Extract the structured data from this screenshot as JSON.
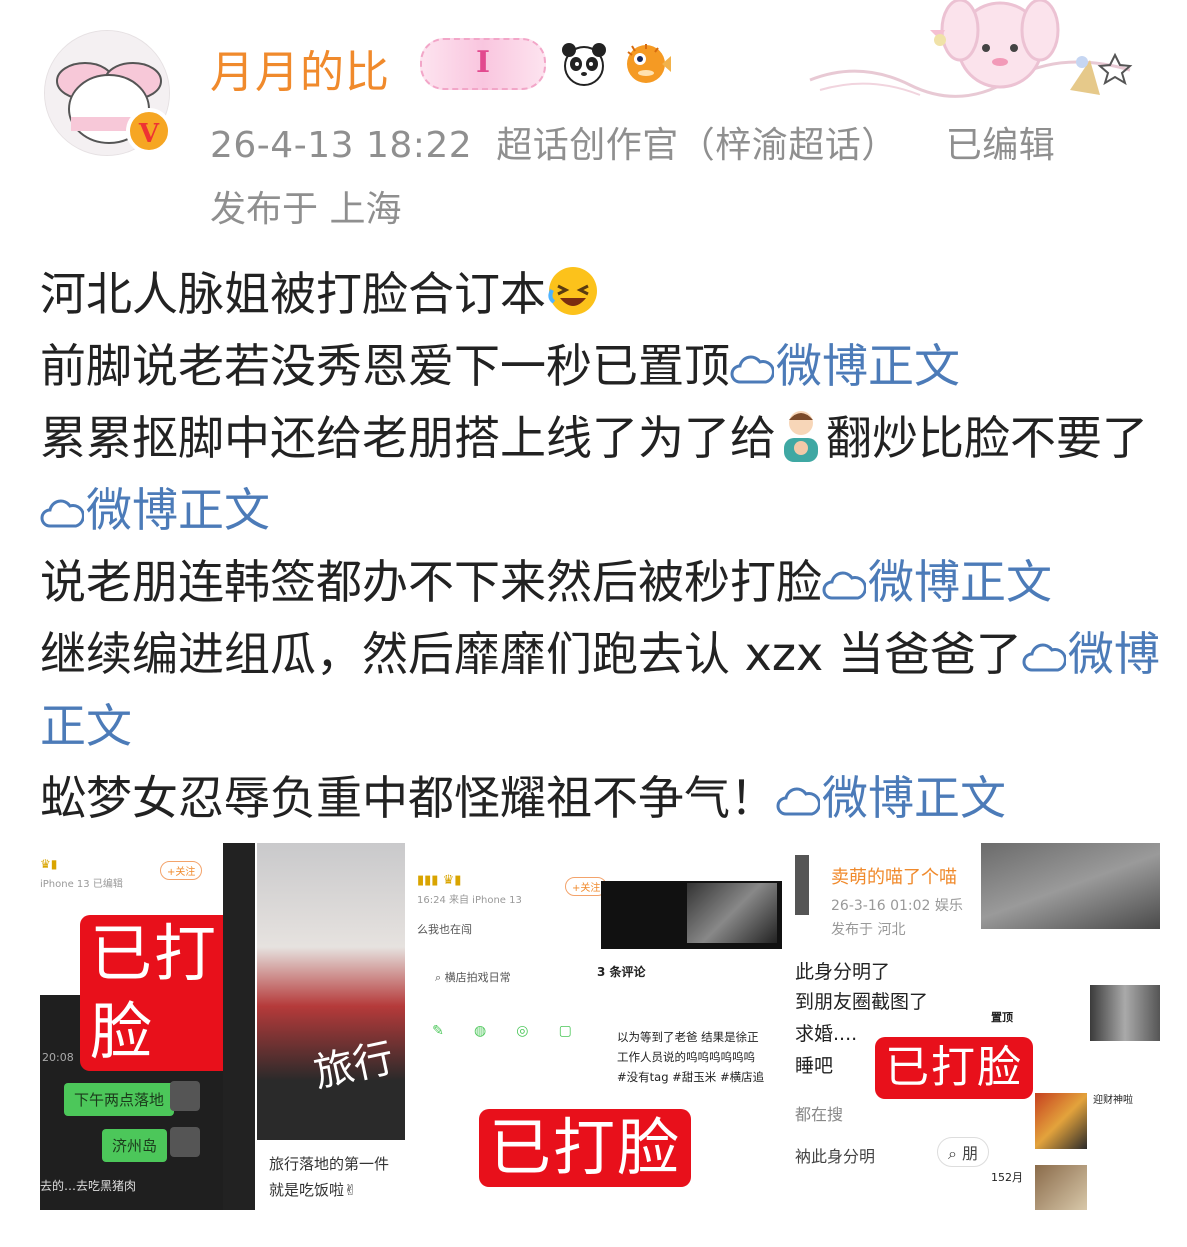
{
  "header": {
    "username": "月月的比",
    "badge_pill_text": "I",
    "icon_panda": "panda-emoji-icon",
    "icon_fish": "pufferfish-emoji-icon",
    "timestamp": "26-4-13 18:22",
    "source": "超话创作官（梓渝超话）",
    "edited": "已编辑",
    "location": "发布于 上海"
  },
  "post": {
    "line1": "河北人脉姐被打脸合订本",
    "line2": "前脚说老若没秀恩爱下一秒已置顶",
    "line3a": "累累抠脚中还给老朋搭上线了为了给",
    "line3b": "翻炒比脸不要了",
    "line4": "说老朋连韩签都办不下来然后被秒打脸",
    "line5": "继续编进组瓜，然后靡靡们跑去认 xzx 当爸爸了",
    "line6": "蚣梦女忍辱负重中都怪耀祖不争气！",
    "link_label": "微博正文"
  },
  "images": {
    "stamp": "已打脸",
    "tile1": {
      "device": "iPhone 13  已编辑",
      "follow": "+关注",
      "time": "20:08",
      "bubble1": "下午两点落地",
      "bubble2": "济州岛",
      "bottom": "去的…去吃黑猪肉"
    },
    "tile2": {
      "overlay": "旅行",
      "caption1": "旅行落地的第一件",
      "caption2": "就是吃饭啦✌"
    },
    "tile3": {
      "meta": "16:24  来自 iPhone 13",
      "follow": "+关注",
      "line1": "么我也在闯",
      "search": "横店拍戏日常",
      "comments": "3 条评论",
      "c1": "以为等到了老爸 结果是徐正",
      "c2": "工作人员说的呜呜呜呜呜呜",
      "c3": "#没有tag #甜玉米 #横店追"
    },
    "tile4": {
      "name": "卖萌的喵了个喵",
      "time": "26-3-16 01:02  娱乐",
      "loc": "发布于 河北",
      "t1": "此身分明了",
      "t2": "到朋友圈截图了",
      "t3": "求婚....",
      "t4": "睡吧",
      "t5": "都在搜",
      "t6": "衲此身分明",
      "pin": "置顶",
      "friend": "朋",
      "god": "迎财神啦",
      "date": "15",
      "mon": "2月"
    }
  }
}
